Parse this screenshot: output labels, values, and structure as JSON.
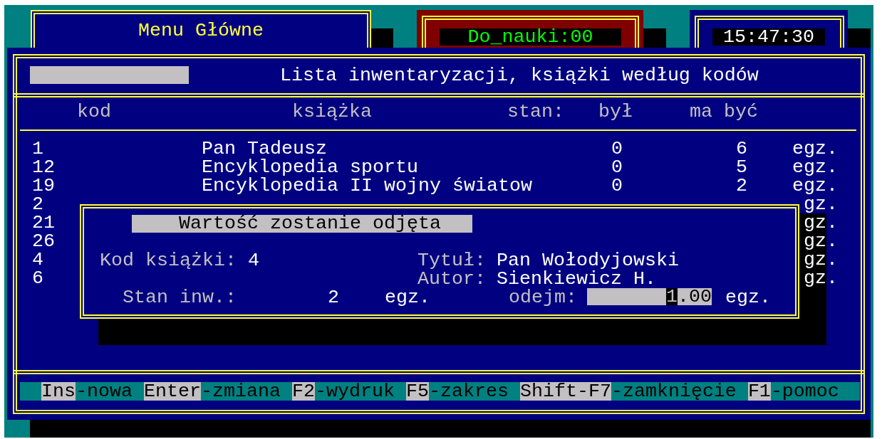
{
  "menu_window": {
    "title": "Menu Główne"
  },
  "timer_window": {
    "text": "Do_nauki:00"
  },
  "clock_window": {
    "time": "15:47:30"
  },
  "main_window": {
    "title": "Lista inwentaryzacji, książki według kodów",
    "columns": [
      "kod",
      "książka",
      "stan:",
      "był",
      "ma być"
    ],
    "rows": [
      {
        "code": "1",
        "title": "Pan Tadeusz",
        "was": "0",
        "target": "6",
        "unit": "egz."
      },
      {
        "code": "12",
        "title": "Encyklopedia sportu",
        "was": "0",
        "target": "5",
        "unit": "egz."
      },
      {
        "code": "19",
        "title": "Encyklopedia II wojny światow",
        "was": "0",
        "target": "2",
        "unit": "egz."
      },
      {
        "code": "2",
        "unit": "gz."
      },
      {
        "code": "21",
        "unit": "gz."
      },
      {
        "code": "26",
        "unit": "gz."
      },
      {
        "code": "4",
        "unit": "gz."
      },
      {
        "code": "6",
        "unit": "gz."
      }
    ],
    "dialog": {
      "title": "Wartość zostanie odjęta",
      "code_label": "Kod książki:",
      "code": "4",
      "title_label": "Tytuł:",
      "book_title": "Pan Wołodyjowski",
      "author_label": "Autor:",
      "author": "Sienkiewicz H.",
      "stock_label": "Stan inw.:",
      "stock": "2",
      "stock_unit": "egz.",
      "subtract_label": "odejm:",
      "subtract_value": "1.00",
      "subtract_unit": "egz."
    },
    "shortcuts": [
      {
        "key": "Ins",
        "action": "-nowa"
      },
      {
        "key": "Enter",
        "action": "-zmiana"
      },
      {
        "key": "F2",
        "action": "-wydruk"
      },
      {
        "key": "F5",
        "action": "-zakres"
      },
      {
        "key": "Shift-F7",
        "action": "-zamknięcie"
      },
      {
        "key": "F1",
        "action": "-pomoc"
      }
    ]
  }
}
